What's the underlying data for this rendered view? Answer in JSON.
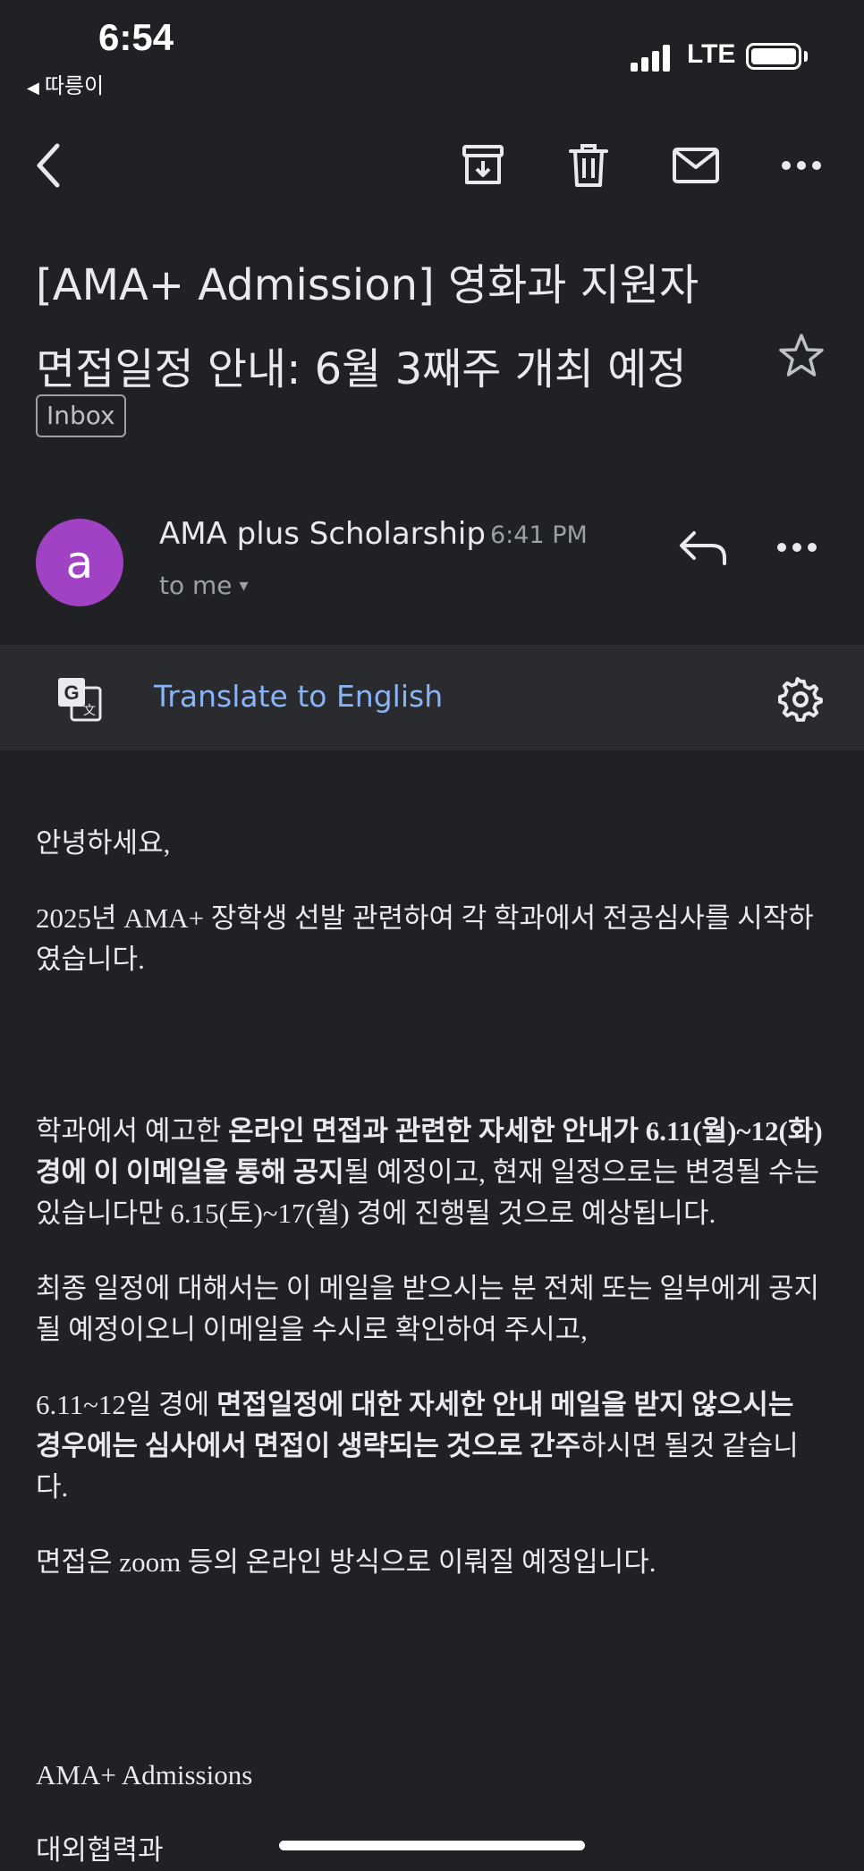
{
  "status_bar": {
    "time": "6:54",
    "back_app": "따릉이",
    "network": "LTE"
  },
  "toolbar": {
    "icons": [
      "back-icon",
      "archive-icon",
      "trash-icon",
      "mail-icon",
      "more-icon"
    ]
  },
  "email": {
    "subject_line1": "[AMA+ Admission] 영화과 지원자",
    "subject_line2": "면접일정 안내: 6월 3째주 개최 예정",
    "label": "Inbox",
    "sender_initial": "a",
    "sender_name": "AMA plus Scholarship",
    "time": "6:41 PM",
    "recipient": "to me",
    "avatar_color": "#a142c4"
  },
  "translate": {
    "link": "Translate to English",
    "link_color": "#8ab4f8"
  },
  "body": {
    "greeting": "안녕하세요,",
    "p1": "2025년 AMA+ 장학생 선발 관련하여 각 학과에서 전공심사를 시작하였습니다.",
    "p2_a": "학과에서 예고한 ",
    "p2_b": "온라인 면접과 관련한 자세한 안내가 6.11(월)~12(화) 경에 이 이메일을 통해 공지",
    "p2_c": "될 예정이고, 현재 일정으로는 변경될 수는 있습니다만 6.15(토)~17(월) 경에 진행될 것으로 예상됩니다.",
    "p3": "최종 일정에 대해서는 이 메일을 받으시는 분 전체 또는 일부에게 공지될 예정이오니 이메일을 수시로 확인하여 주시고,",
    "p4_a": "6.11~12일 경에 ",
    "p4_b": "면접일정에 대한 자세한 안내 메일을 받지 않으시는 경우에는 심사에서 면접이 생략되는 것으로 간주",
    "p4_c": "하시면 될것 같습니다.",
    "p5": "면접은 zoom 등의 온라인 방식으로 이뤄질 예정입니다.",
    "signature_1": "AMA+ Admissions",
    "signature_2": "대외협력과"
  }
}
